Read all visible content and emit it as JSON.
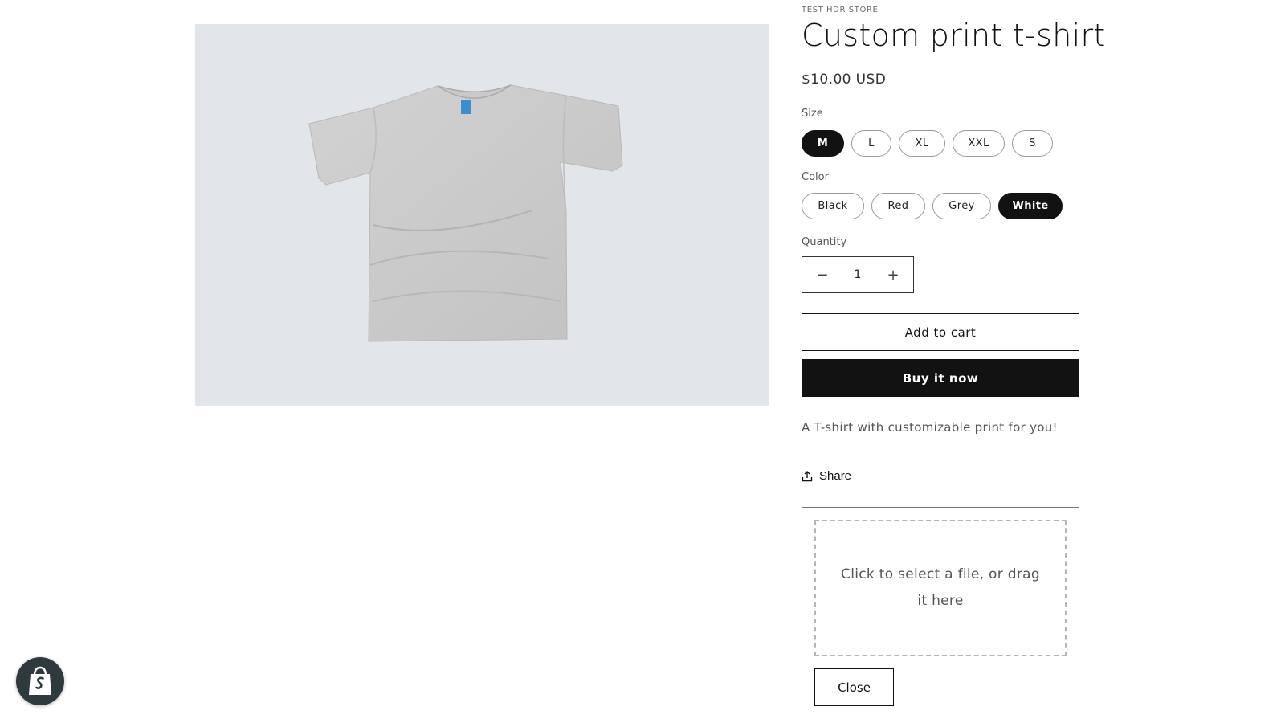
{
  "store": {
    "vendor": "TEST HDR STORE"
  },
  "product": {
    "title": "Custom print t-shirt",
    "price": "$10.00 USD",
    "description": "A T-shirt with customizable print for you!",
    "image_icon": "tshirt-image"
  },
  "options": {
    "size": {
      "label": "Size",
      "values": [
        "M",
        "L",
        "XL",
        "XXL",
        "S"
      ],
      "selected": "M"
    },
    "color": {
      "label": "Color",
      "values": [
        "Black",
        "Red",
        "Grey",
        "White"
      ],
      "selected": "White"
    }
  },
  "quantity": {
    "label": "Quantity",
    "value": "1",
    "minus_symbol": "−",
    "plus_symbol": "+"
  },
  "actions": {
    "add_to_cart": "Add to cart",
    "buy_now": "Buy it now",
    "share": "Share",
    "share_icon": "share-icon"
  },
  "upload": {
    "dropzone_text": "Click to select a file, or drag it here",
    "close_label": "Close"
  },
  "badge": {
    "icon": "shopify-bag-icon"
  },
  "colors": {
    "accent": "#121212",
    "media_background": "#e2e6ea"
  }
}
